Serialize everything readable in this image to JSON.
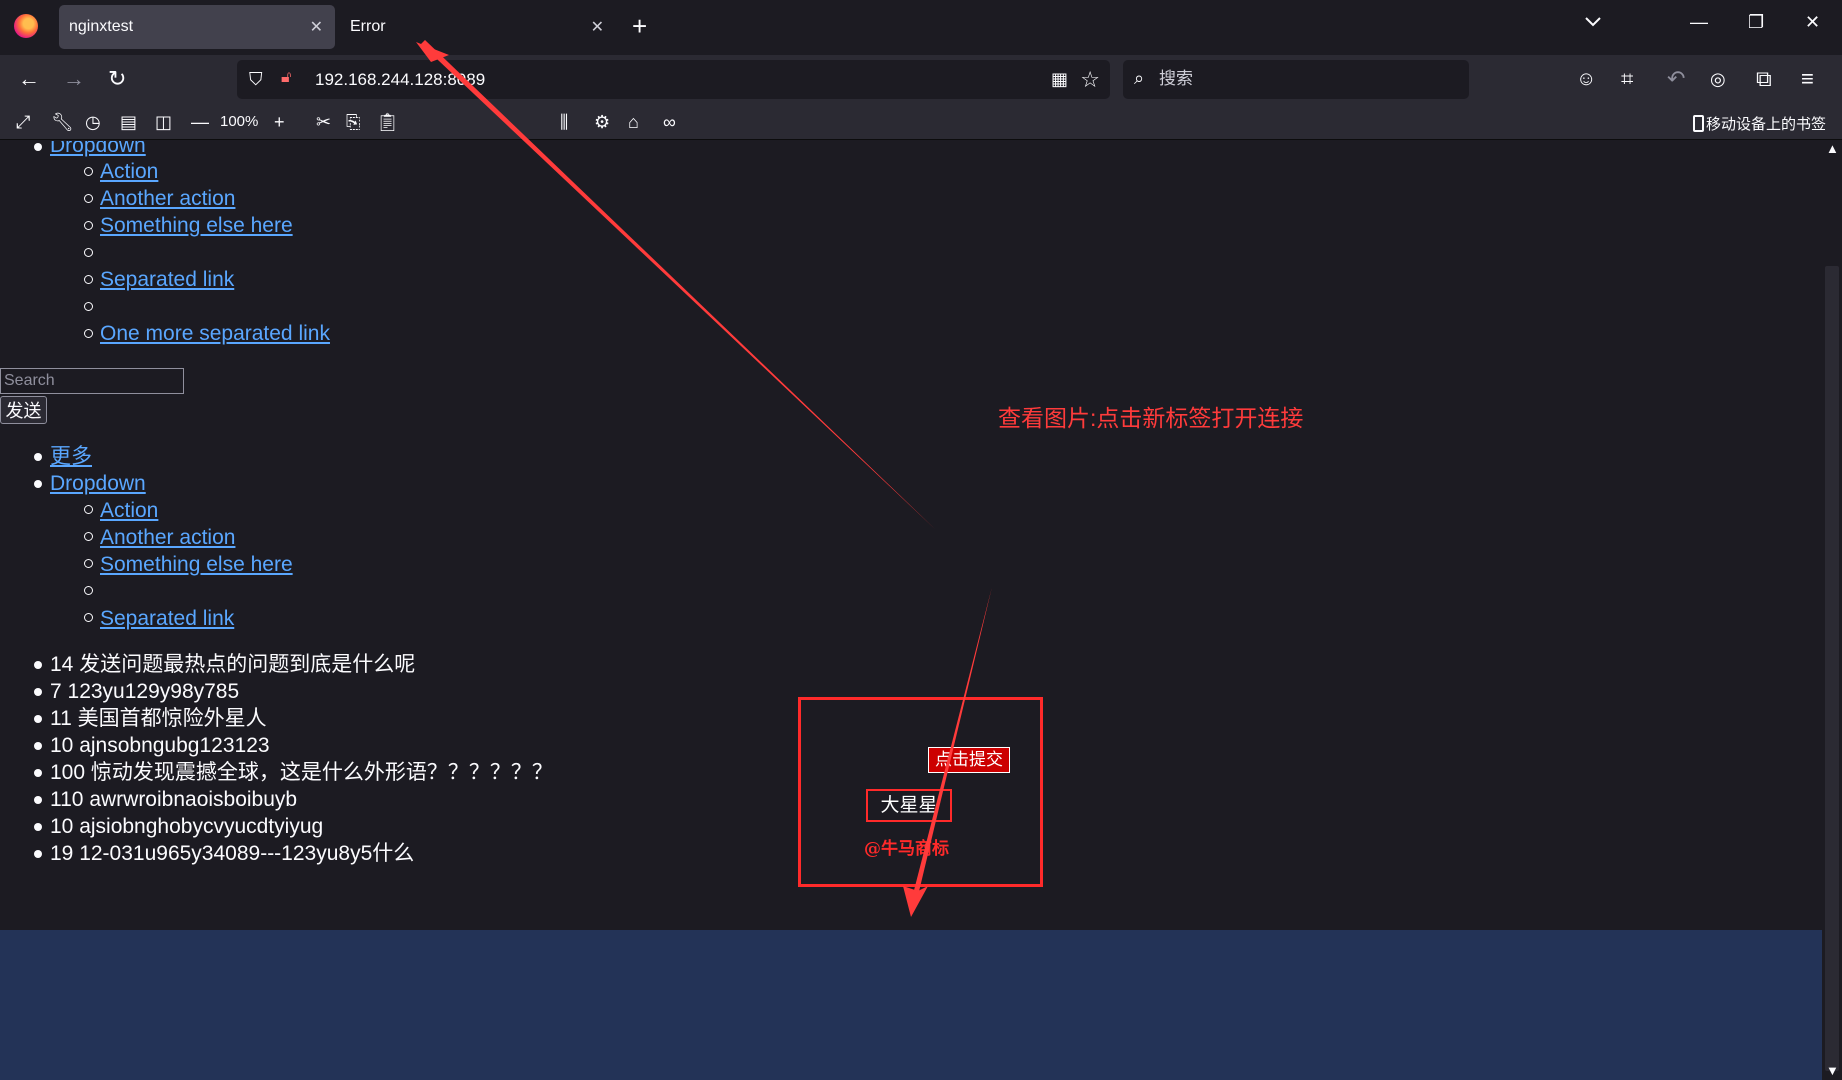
{
  "browser": {
    "tabs": [
      {
        "title": "nginxtest",
        "active": true
      },
      {
        "title": "Error",
        "active": false
      }
    ],
    "url": "192.168.244.128:8089",
    "search_placeholder": "搜索",
    "zoom": "100%",
    "mobile_bookmarks": "移动设备上的书签"
  },
  "page": {
    "nav_top": {
      "dropdown": "Dropdown",
      "items": [
        "Action",
        "Another action",
        "Something else here",
        "",
        "Separated link",
        "",
        "One more separated link"
      ]
    },
    "search": {
      "placeholder": "Search",
      "button": "发送"
    },
    "nav_second": {
      "more": "更多",
      "dropdown": "Dropdown",
      "items": [
        "Action",
        "Another action",
        "Something else here",
        "",
        "Separated link"
      ]
    },
    "questions": [
      "14 发送问题最热点的问题到底是什么呢",
      "7 123yu129y98y785",
      "11 美国首都惊险外星人",
      "10 ajnsobngubg123123",
      "100 惊动发现震撼全球，这是什么外形语？？？？？？",
      "110 awrwroibnaoisboibuyb",
      "10 ajsiobnghobycvyucdtyiyug",
      "19 12-031u965y34089---123yu8y5什么"
    ],
    "submit_button": "点击提交",
    "user_name": "大星星",
    "brand_watermark": "@牛马商标"
  },
  "annotation": {
    "text": "查看图片:点击新标签打开连接",
    "color": "#ff3b3b"
  },
  "colors": {
    "link": "#5aa7ff",
    "footer_bg": "#233357",
    "content_bg": "#1c1b22",
    "toolbar_bg": "#2b2a33"
  }
}
